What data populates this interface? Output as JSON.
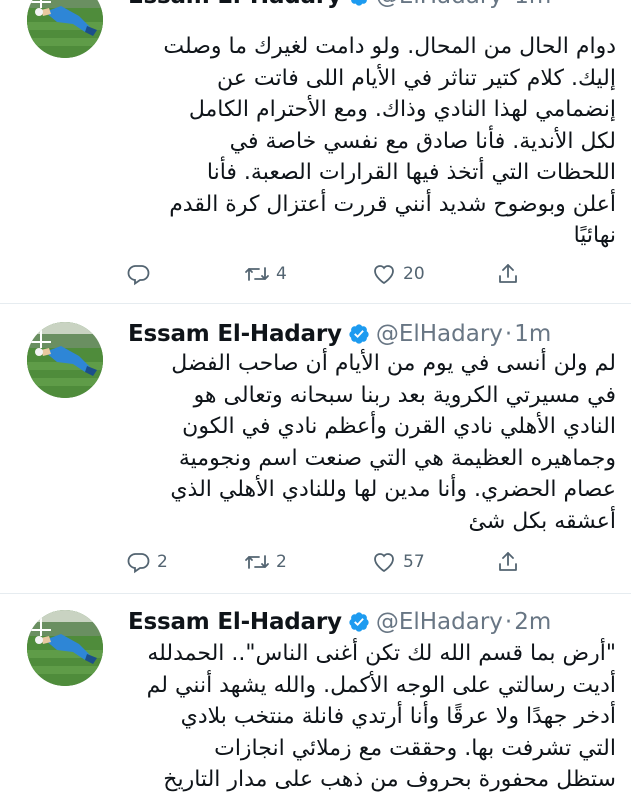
{
  "tweets": [
    {
      "name": "Essam El-Hadary",
      "handle": "@ElHadary",
      "dot": "·",
      "time": "1m",
      "lines": [
        "دوام الحال من المحال. ولو دامت لغيرك ما وصلت",
        "إليك. كلام كتير تناثر في الأيام اللى فاتت عن",
        "إنضمامي لهذا النادي وذاك. ومع الأحترام الكامل",
        "لكل الأندية. فأنا صادق مع نفسي خاصة في",
        "اللحظات التي أتخذ فيها القرارات الصعبة. فأنا",
        "أعلن وبوضوح شديد أنني قررت أعتزال كرة القدم",
        "نهائيًا"
      ],
      "replies": "",
      "retweets": "4",
      "likes": "20"
    },
    {
      "name": "Essam El-Hadary",
      "handle": "@ElHadary",
      "dot": "·",
      "time": "1m",
      "lines": [
        "لم ولن أنسى في يوم من الأيام أن صاحب الفضل",
        "في مسيرتي الكروية بعد ربنا سبحانه وتعالى هو",
        "النادي الأهلي نادي القرن وأعظم نادي في الكون",
        "وجماهيره العظيمة هي التي صنعت اسم ونجومية",
        "عصام الحضري. وأنا مدين لها وللنادي الأهلي الذي",
        "أعشقه بكل شئ"
      ],
      "replies": "2",
      "retweets": "2",
      "likes": "57"
    },
    {
      "name": "Essam El-Hadary",
      "handle": "@ElHadary",
      "dot": "·",
      "time": "2m",
      "lines": [
        "\"أرض بما قسم الله لك تكن أغنى الناس\".. الحمدلله",
        "أديت رسالتي على الوجه الأكمل. والله يشهد أنني لم",
        "أدخر جهدًا ولا عرقًا وأنا أرتدي فانلة منتخب بلادي",
        "التي تشرفت بها. وحققت مع زملائي انجازات",
        "ستظل محفورة بحروف من ذهب على مدار التاريخ"
      ],
      "replies": "",
      "retweets": "",
      "likes": ""
    }
  ],
  "colors": {
    "verified": "#1d9bf0",
    "text": "#0f1419",
    "muted": "#687684",
    "divider": "#e6ecf0"
  },
  "icons": [
    "avatar-photo",
    "verified-badge-icon",
    "reply-icon",
    "retweet-icon",
    "like-icon",
    "share-icon"
  ]
}
